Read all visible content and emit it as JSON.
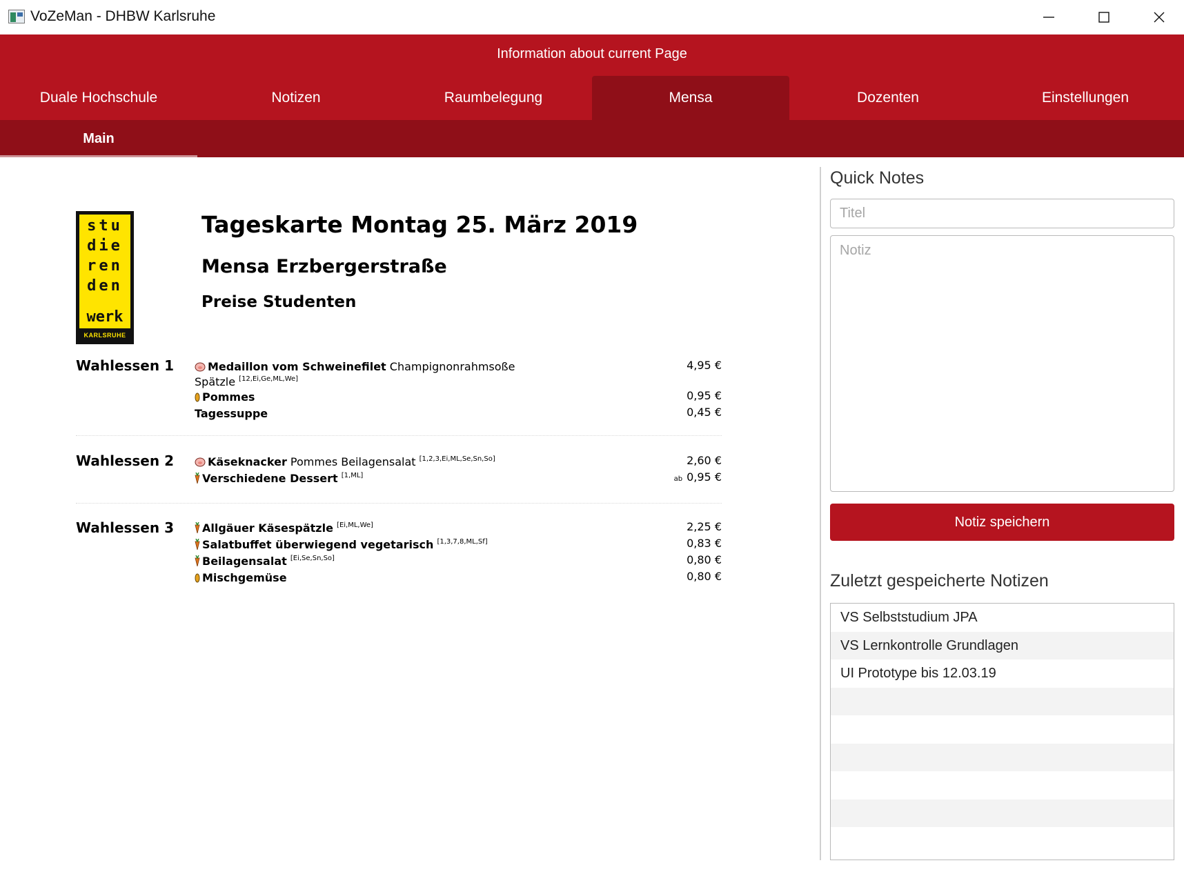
{
  "window": {
    "title": "VoZeMan - DHBW Karlsruhe"
  },
  "header": {
    "info": "Information about current Page",
    "tabs": [
      {
        "label": "Duale Hochschule",
        "active": false
      },
      {
        "label": "Notizen",
        "active": false
      },
      {
        "label": "Raumbelegung",
        "active": false
      },
      {
        "label": "Mensa",
        "active": true
      },
      {
        "label": "Dozenten",
        "active": false
      },
      {
        "label": "Einstellungen",
        "active": false
      }
    ],
    "subtab": "Main"
  },
  "mensa": {
    "logo": {
      "lines": [
        "stu",
        "die",
        "ren",
        "den",
        "werk"
      ],
      "city": "KARLSRUHE"
    },
    "title": "Tageskarte Montag 25. März 2019",
    "location": "Mensa Erzbergerstraße",
    "price_group": "Preise Studenten",
    "groups": [
      {
        "name": "Wahlessen 1",
        "items": [
          {
            "icon": "pig-icon",
            "name": "Medaillon vom Schweinefilet",
            "desc": " Champignonrahmsoße",
            "desc2": "Spätzle",
            "allergens": "[12,Ei,Ge,ML,We]",
            "price": "4,95 €"
          },
          {
            "icon": "leaf-icon",
            "name": "Pommes",
            "price": "0,95 €"
          },
          {
            "icon": "",
            "name": "Tagessuppe",
            "price": "0,45 €"
          }
        ]
      },
      {
        "name": "Wahlessen 2",
        "items": [
          {
            "icon": "pig-icon",
            "name": "Käseknacker",
            "desc": " Pommes Beilagensalat ",
            "allergens": "[1,2,3,Ei,ML,Se,Sn,So]",
            "price": "2,60 €"
          },
          {
            "icon": "carrot-icon",
            "name": "Verschiedene Dessert",
            "allergens": "[1,ML]",
            "price_prefix": "ab",
            "price": "0,95 €"
          }
        ]
      },
      {
        "name": "Wahlessen 3",
        "items": [
          {
            "icon": "carrot-icon",
            "name": "Allgäuer Käsespätzle",
            "allergens": "[Ei,ML,We]",
            "price": "2,25 €"
          },
          {
            "icon": "carrot-icon",
            "name": "Salatbuffet überwiegend vegetarisch",
            "allergens": "[1,3,7,8,ML,Sf]",
            "price": "0,83 €"
          },
          {
            "icon": "carrot-icon",
            "name": "Beilagensalat",
            "allergens": "[Ei,Se,Sn,So]",
            "price": "0,80 €"
          },
          {
            "icon": "leaf-icon",
            "name": "Mischgemüse",
            "price": "0,80 €"
          }
        ]
      }
    ]
  },
  "quick_notes": {
    "title": "Quick Notes",
    "title_placeholder": "Titel",
    "note_placeholder": "Notiz",
    "save_label": "Notiz speichern",
    "recent_title": "Zuletzt gespeicherte Notizen",
    "recent": [
      "VS Selbststudium JPA",
      "VS Lernkontrolle Grundlagen",
      "UI Prototype bis 12.03.19"
    ],
    "empty_rows": 6
  },
  "colors": {
    "accent": "#b5141f",
    "accent_dark": "#8f0f18",
    "logo_yellow": "#ffe400"
  }
}
